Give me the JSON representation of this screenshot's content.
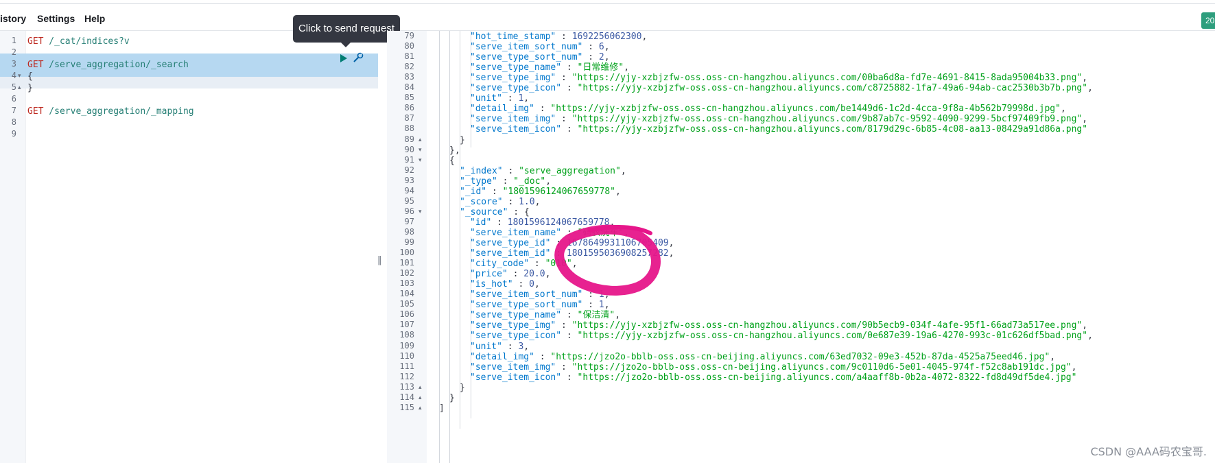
{
  "menu": {
    "history_label": "istory",
    "settings_label": "Settings",
    "help_label": "Help",
    "status_tab": "20"
  },
  "tooltip": {
    "text": "Click to send request"
  },
  "request_editor": {
    "lines": [
      {
        "num": "1",
        "verb": "GET",
        "path": " /_cat/indices?v"
      },
      {
        "num": "2",
        "verb": "",
        "path": ""
      },
      {
        "num": "3",
        "verb": "GET",
        "path": " /serve_aggregation/_search"
      },
      {
        "num": "4",
        "verb": "",
        "path": "{"
      },
      {
        "num": "5",
        "verb": "",
        "path": "}"
      },
      {
        "num": "6",
        "verb": "",
        "path": ""
      },
      {
        "num": "7",
        "verb": "GET",
        "path": " /serve_aggregation/_mapping"
      },
      {
        "num": "8",
        "verb": "",
        "path": ""
      },
      {
        "num": "9",
        "verb": "",
        "path": ""
      }
    ]
  },
  "response": {
    "lines": [
      {
        "num": "79",
        "key": "\"hot_time_stamp\"",
        "sep": " : ",
        "val": "1692256062300",
        "vt": "n",
        "tail": ","
      },
      {
        "num": "80",
        "key": "\"serve_item_sort_num\"",
        "sep": " : ",
        "val": "6",
        "vt": "n",
        "tail": ","
      },
      {
        "num": "81",
        "key": "\"serve_type_sort_num\"",
        "sep": " : ",
        "val": "2",
        "vt": "n",
        "tail": ","
      },
      {
        "num": "82",
        "key": "\"serve_type_name\"",
        "sep": " : ",
        "val": "\"日常维修\"",
        "vt": "s",
        "tail": ","
      },
      {
        "num": "83",
        "key": "\"serve_type_img\"",
        "sep": " : ",
        "val": "\"https://yjy-xzbjzfw-oss.oss-cn-hangzhou.aliyuncs.com/00ba6d8a-fd7e-4691-8415-8ada95004b33.png\"",
        "vt": "s",
        "tail": ","
      },
      {
        "num": "84",
        "key": "\"serve_type_icon\"",
        "sep": " : ",
        "val": "\"https://yjy-xzbjzfw-oss.oss-cn-hangzhou.aliyuncs.com/c8725882-1fa7-49a6-94ab-cac2530b3b7b.png\"",
        "vt": "s",
        "tail": ","
      },
      {
        "num": "85",
        "key": "\"unit\"",
        "sep": " : ",
        "val": "1",
        "vt": "n",
        "tail": ","
      },
      {
        "num": "86",
        "key": "\"detail_img\"",
        "sep": " : ",
        "val": "\"https://yjy-xzbjzfw-oss.oss-cn-hangzhou.aliyuncs.com/be1449d6-1c2d-4cca-9f8a-4b562b79998d.jpg\"",
        "vt": "s",
        "tail": ","
      },
      {
        "num": "87",
        "key": "\"serve_item_img\"",
        "sep": " : ",
        "val": "\"https://yjy-xzbjzfw-oss.oss-cn-hangzhou.aliyuncs.com/9b87ab7c-9592-4090-9299-5bcf97409fb9.png\"",
        "vt": "s",
        "tail": ","
      },
      {
        "num": "88",
        "key": "\"serve_item_icon\"",
        "sep": " : ",
        "val": "\"https://yjy-xzbjzfw-oss.oss-cn-hangzhou.aliyuncs.com/8179d29c-6b85-4c08-aa13-08429a91d86a.png\"",
        "vt": "s",
        "tail": ""
      },
      {
        "num": "89",
        "key": "",
        "sep": "",
        "val": "}",
        "vt": "p",
        "tail": ""
      },
      {
        "num": "90",
        "key": "",
        "sep": "",
        "val": "},",
        "vt": "p",
        "tail": ""
      },
      {
        "num": "91",
        "key": "",
        "sep": "",
        "val": "{",
        "vt": "p",
        "tail": ""
      },
      {
        "num": "92",
        "key": "\"_index\"",
        "sep": " : ",
        "val": "\"serve_aggregation\"",
        "vt": "s",
        "tail": ","
      },
      {
        "num": "93",
        "key": "\"_type\"",
        "sep": " : ",
        "val": "\"_doc\"",
        "vt": "s",
        "tail": ","
      },
      {
        "num": "94",
        "key": "\"_id\"",
        "sep": " : ",
        "val": "\"1801596124067659778\"",
        "vt": "s",
        "tail": ","
      },
      {
        "num": "95",
        "key": "\"_score\"",
        "sep": " : ",
        "val": "1.0",
        "vt": "n",
        "tail": ","
      },
      {
        "num": "96",
        "key": "\"_source\"",
        "sep": " : ",
        "val": "{",
        "vt": "p",
        "tail": ""
      },
      {
        "num": "97",
        "key": "\"id\"",
        "sep": " : ",
        "val": "1801596124067659778",
        "vt": "n",
        "tail": ","
      },
      {
        "num": "98",
        "key": "\"serve_item_name\"",
        "sep": " : ",
        "val": "\"码农洗车\"",
        "vt": "s",
        "tail": ","
      },
      {
        "num": "99",
        "key": "\"serve_type_id\"",
        "sep": " : ",
        "val": "1678649931106705409",
        "vt": "n",
        "tail": ","
      },
      {
        "num": "100",
        "key": "\"serve_item_id\"",
        "sep": " : ",
        "val": "1801595036908257282",
        "vt": "n",
        "tail": ","
      },
      {
        "num": "101",
        "key": "\"city_code\"",
        "sep": " : ",
        "val": "\"010\"",
        "vt": "s",
        "tail": ","
      },
      {
        "num": "102",
        "key": "\"price\"",
        "sep": " : ",
        "val": "20.0",
        "vt": "n",
        "tail": ","
      },
      {
        "num": "103",
        "key": "\"is_hot\"",
        "sep": " : ",
        "val": "0",
        "vt": "n",
        "tail": ","
      },
      {
        "num": "104",
        "key": "\"serve_item_sort_num\"",
        "sep": " : ",
        "val": "1",
        "vt": "n",
        "tail": ","
      },
      {
        "num": "105",
        "key": "\"serve_type_sort_num\"",
        "sep": " : ",
        "val": "1",
        "vt": "n",
        "tail": ","
      },
      {
        "num": "106",
        "key": "\"serve_type_name\"",
        "sep": " : ",
        "val": "\"保洁清\"",
        "vt": "s",
        "tail": ","
      },
      {
        "num": "107",
        "key": "\"serve_type_img\"",
        "sep": " : ",
        "val": "\"https://yjy-xzbjzfw-oss.oss-cn-hangzhou.aliyuncs.com/90b5ecb9-034f-4afe-95f1-66ad73a517ee.png\"",
        "vt": "s",
        "tail": ","
      },
      {
        "num": "108",
        "key": "\"serve_type_icon\"",
        "sep": " : ",
        "val": "\"https://yjy-xzbjzfw-oss.oss-cn-hangzhou.aliyuncs.com/0e687e39-19a6-4270-993c-01c626df5bad.png\"",
        "vt": "s",
        "tail": ","
      },
      {
        "num": "109",
        "key": "\"unit\"",
        "sep": " : ",
        "val": "3",
        "vt": "n",
        "tail": ","
      },
      {
        "num": "110",
        "key": "\"detail_img\"",
        "sep": " : ",
        "val": "\"https://jzo2o-bblb-oss.oss-cn-beijing.aliyuncs.com/63ed7032-09e3-452b-87da-4525a75eed46.jpg\"",
        "vt": "s",
        "tail": ","
      },
      {
        "num": "111",
        "key": "\"serve_item_img\"",
        "sep": " : ",
        "val": "\"https://jzo2o-bblb-oss.oss-cn-beijing.aliyuncs.com/9c0110d6-5e01-4045-974f-f52c8ab191dc.jpg\"",
        "vt": "s",
        "tail": ","
      },
      {
        "num": "112",
        "key": "\"serve_item_icon\"",
        "sep": " : ",
        "val": "\"https://jzo2o-bblb-oss.oss-cn-beijing.aliyuncs.com/a4aaff8b-0b2a-4072-8322-fd8d49df5de4.jpg\"",
        "vt": "s",
        "tail": ""
      },
      {
        "num": "113",
        "key": "",
        "sep": "",
        "val": "}",
        "vt": "p",
        "tail": ""
      },
      {
        "num": "114",
        "key": "",
        "sep": "",
        "val": "}",
        "vt": "p",
        "tail": ""
      },
      {
        "num": "115",
        "key": "",
        "sep": "",
        "val": "]",
        "vt": "p",
        "tail": ""
      }
    ]
  },
  "watermark": "CSDN @AAA码农宝哥.",
  "colors": {
    "verb": "#bd271e",
    "path": "#267f75",
    "key": "#0077cc",
    "string": "#00a11a",
    "number": "#3b59a3",
    "selection": "#b6d8f1",
    "scribble": "#e6168a"
  }
}
